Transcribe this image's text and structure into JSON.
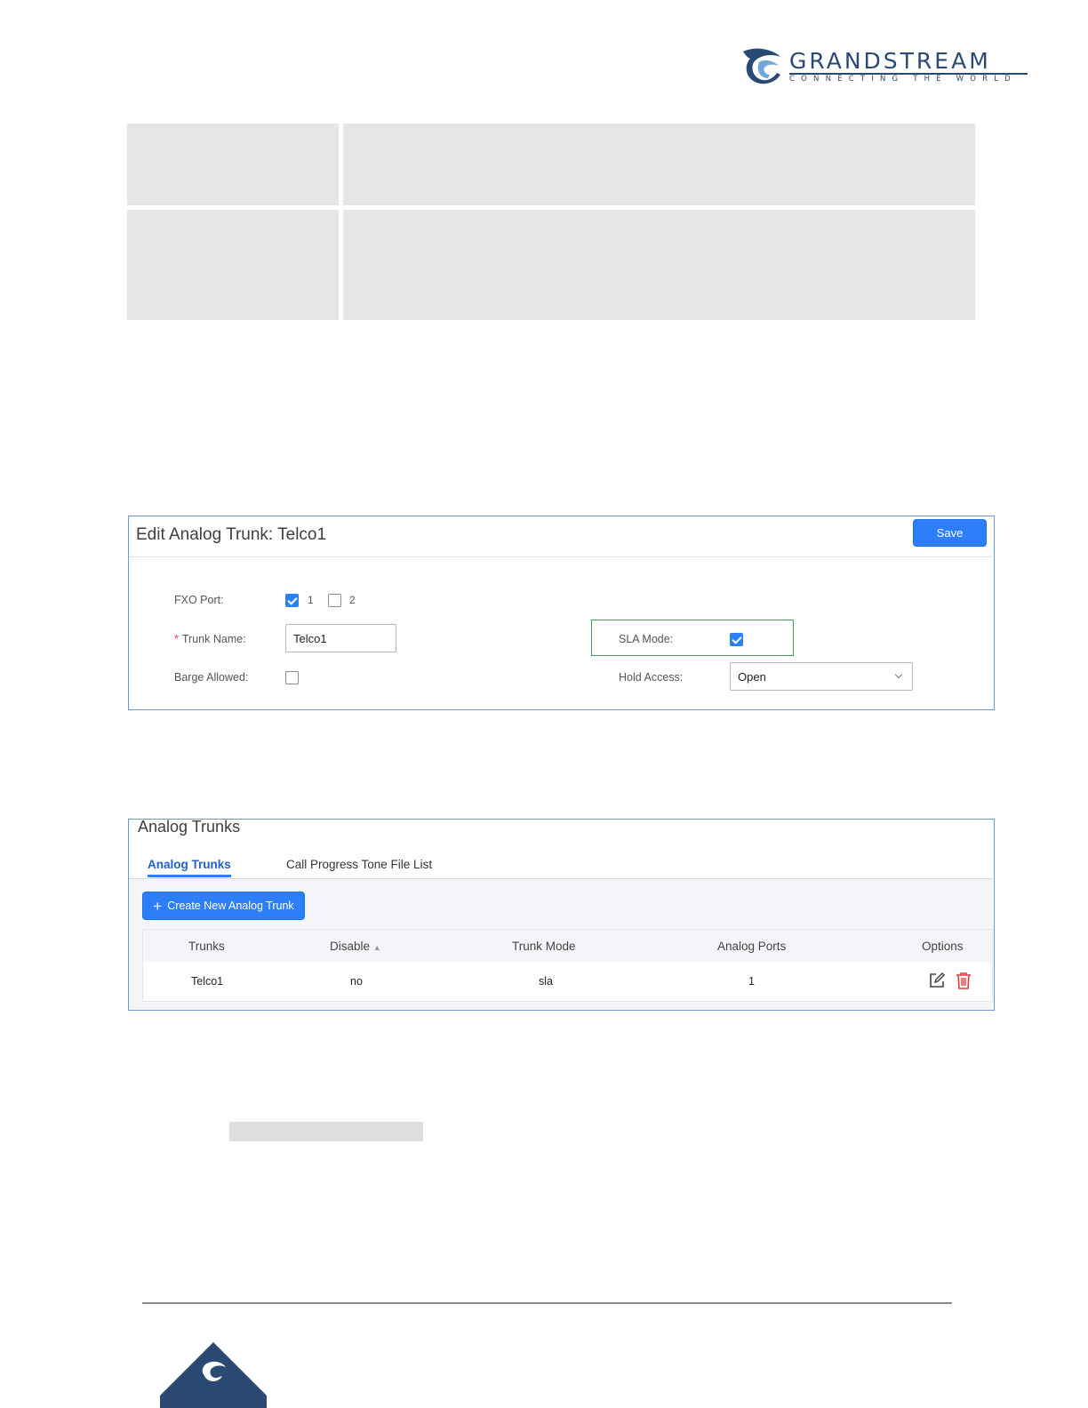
{
  "logo": {
    "name": "GRANDSTREAM",
    "tagline": "CONNECTING THE WORLD",
    "brand_color": "#2b4a73",
    "icon": "grandstream-swirl-icon"
  },
  "edit_panel": {
    "title": "Edit Analog Trunk: Telco1",
    "save_label": "Save",
    "fxo_port_label": "FXO Port:",
    "fxo_ports": [
      {
        "label": "1",
        "checked": true
      },
      {
        "label": "2",
        "checked": false
      }
    ],
    "trunk_name_label": "Trunk Name:",
    "trunk_name_required": "*",
    "trunk_name_value": "Telco1",
    "barge_allowed_label": "Barge Allowed:",
    "barge_allowed_checked": false,
    "sla_mode_label": "SLA Mode:",
    "sla_mode_checked": true,
    "hold_access_label": "Hold Access:",
    "hold_access_value": "Open"
  },
  "trunks_panel": {
    "title": "Analog Trunks",
    "tabs": [
      {
        "label": "Analog Trunks",
        "active": true
      },
      {
        "label": "Call Progress Tone File List",
        "active": false
      }
    ],
    "create_button_label": "Create New Analog Trunk",
    "columns": [
      "Trunks",
      "Disable",
      "Trunk Mode",
      "Analog Ports",
      "Options"
    ],
    "rows": [
      {
        "trunk": "Telco1",
        "disable": "no",
        "mode": "sla",
        "ports": "1"
      }
    ]
  },
  "colors": {
    "accent": "#2d7ff9",
    "panel_border": "#6d99c9",
    "sla_highlight": "#3e9e5a",
    "delete": "#e03c3c"
  }
}
